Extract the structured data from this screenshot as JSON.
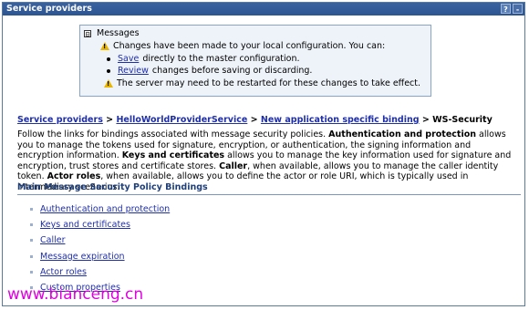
{
  "window": {
    "title": "Service providers",
    "help_label": "?",
    "close_label": "-"
  },
  "messages": {
    "title": "Messages",
    "toggle": "⊟",
    "line1": "Changes have been made to your local configuration. You can:",
    "save_link": "Save",
    "save_text": " directly to the master configuration.",
    "review_link": "Review",
    "review_text": " changes before saving or discarding.",
    "line4": "The server may need to be restarted for these changes to take effect."
  },
  "breadcrumb": {
    "items": [
      "Service providers",
      "HelloWorldProviderService",
      "New application specific binding"
    ],
    "separator": " > ",
    "current": "WS-Security"
  },
  "description": {
    "t1": "Follow the links for bindings associated with message security policies. ",
    "b1": "Authentication and protection",
    "t2": " allows you to manage the tokens used for signature, encryption, or authentication, the signing information and encryption information. ",
    "b2": "Keys and certificates",
    "t3": " allows you to manage the key information used for signature and encryption, trust stores and certificate stores. ",
    "b3": "Caller",
    "t4": ", when available, allows you to manage the caller identity token. ",
    "b4": "Actor roles",
    "t5": ", when available, allows you to define the actor or role URI, which is typically used in intermediary scenarios."
  },
  "section": {
    "title": "Main Message Security Policy Bindings",
    "links": [
      "Authentication and protection",
      "Keys and certificates",
      "Caller",
      "Message expiration",
      "Actor roles",
      "Custom properties"
    ]
  },
  "watermark": "www.bianceng.cn"
}
